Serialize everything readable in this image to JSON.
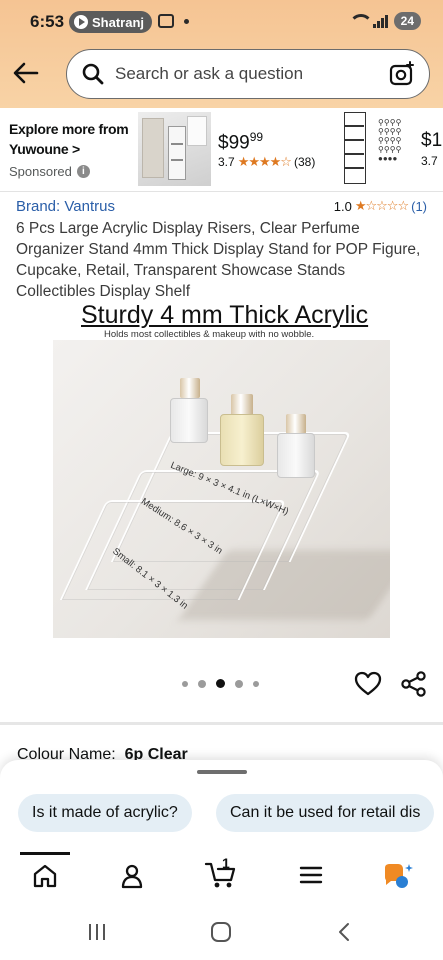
{
  "status_bar": {
    "time": "6:53",
    "chip_label": "Shatranj",
    "battery": "24"
  },
  "search": {
    "placeholder": "Search or ask a question"
  },
  "sponsored": {
    "brand_line1": "Explore more from",
    "brand_line2": "Yuwoune",
    "brand_chevron": ">",
    "sponsored_label": "Sponsored",
    "product1": {
      "price_whole": "$99",
      "price_fraction": "99",
      "rating": "3.7",
      "stars": "★★★★☆",
      "review_count": "(38)"
    },
    "product2": {
      "price_partial": "$1",
      "rating": "3.7"
    }
  },
  "product": {
    "brand": "Brand: Vantrus",
    "rating": "1.0",
    "stars": "★☆☆☆☆",
    "review_count": "(1)",
    "title": "6 Pcs Large Acrylic Display Risers, Clear Perfume Organizer Stand 4mm Thick Display Stand for POP Figure, Cupcake, Retail, Transparent Showcase Stands Collectibles Display Shelf"
  },
  "image": {
    "heading": "Sturdy 4 mm Thick Acrylic",
    "subheading": "Holds most collectibles & makeup with no wobble.",
    "dim_large": "Large: 9 × 3 × 4.1 in (L×W×H)",
    "dim_medium": "Medium: 8.6 × 3 × 3 in",
    "dim_small": "Small: 8.1 × 3 × 1.3 in",
    "carousel_count": 5,
    "carousel_active_index": 2
  },
  "variant": {
    "label": "Colour Name:",
    "value": "6p Clear"
  },
  "suggestions": [
    "Is it made of acrylic?",
    "Can it be used for retail dis"
  ],
  "nav": {
    "cart_count": "1"
  },
  "colors": {
    "header_orange": "#f5c493",
    "link_blue": "#2a5ea8",
    "star_orange": "#de7921",
    "chip_bg": "#e4eef5"
  }
}
